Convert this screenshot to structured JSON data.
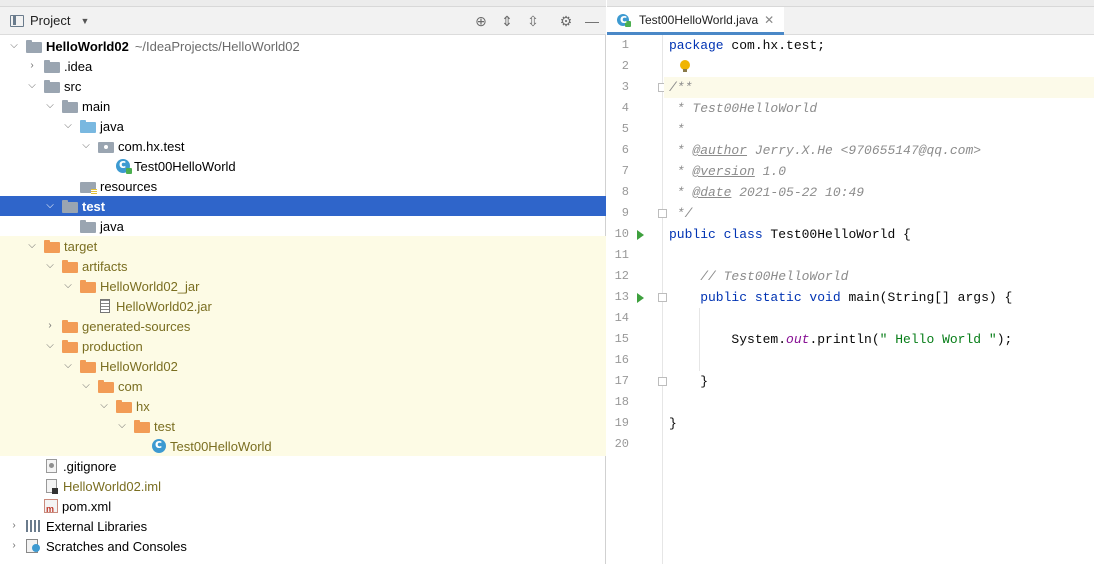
{
  "project_panel": {
    "title": "Project",
    "tree": [
      {
        "label": "HelloWorld02",
        "path": "~/IdeaProjects/HelloWorld02"
      },
      {
        "label": ".idea"
      },
      {
        "label": "src"
      },
      {
        "label": "main"
      },
      {
        "label": "java"
      },
      {
        "label": "com.hx.test"
      },
      {
        "label": "Test00HelloWorld"
      },
      {
        "label": "resources"
      },
      {
        "label": "test"
      },
      {
        "label": "java"
      },
      {
        "label": "target"
      },
      {
        "label": "artifacts"
      },
      {
        "label": "HelloWorld02_jar"
      },
      {
        "label": "HelloWorld02.jar"
      },
      {
        "label": "generated-sources"
      },
      {
        "label": "production"
      },
      {
        "label": "HelloWorld02"
      },
      {
        "label": "com"
      },
      {
        "label": "hx"
      },
      {
        "label": "test"
      },
      {
        "label": "Test00HelloWorld"
      },
      {
        "label": ".gitignore"
      },
      {
        "label": "HelloWorld02.iml"
      },
      {
        "label": "pom.xml"
      },
      {
        "label": "External Libraries"
      },
      {
        "label": "Scratches and Consoles"
      }
    ]
  },
  "editor": {
    "tab_label": "Test00HelloWorld.java",
    "lines": {
      "l1_kw": "package",
      "l1_rest": " com.hx.test;",
      "l3": "/**",
      "l4": " * Test00HelloWorld",
      "l5": " *",
      "l6_a": " * ",
      "l6_tag": "@author",
      "l6_b": " Jerry.X.He <970655147@qq.com>",
      "l7_a": " * ",
      "l7_tag": "@version",
      "l7_b": " 1.0",
      "l8_a": " * ",
      "l8_tag": "@date",
      "l8_b": " 2021-05-22 10:49",
      "l9": " */",
      "l10_kw": "public class",
      "l10_rest": " Test00HelloWorld {",
      "l12": "    // Test00HelloWorld",
      "l13_kw": "    public static void",
      "l13_rest": " main(String[] args) {",
      "l15_a": "        System.",
      "l15_fld": "out",
      "l15_b": ".println(",
      "l15_str": "\" Hello World \"",
      "l15_c": ");",
      "l17": "    }",
      "l19": "}"
    },
    "line_numbers": [
      "1",
      "2",
      "3",
      "4",
      "5",
      "6",
      "7",
      "8",
      "9",
      "10",
      "11",
      "12",
      "13",
      "14",
      "15",
      "16",
      "17",
      "18",
      "19",
      "20"
    ]
  }
}
